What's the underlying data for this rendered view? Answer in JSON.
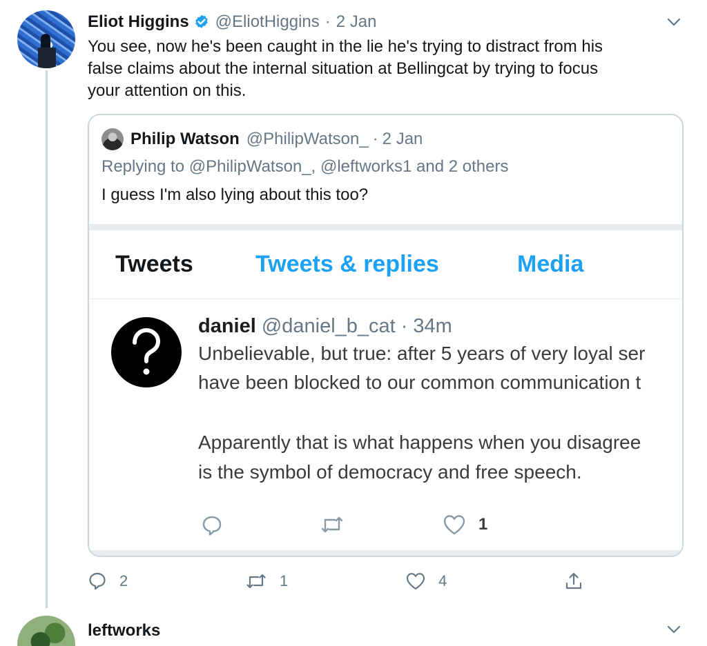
{
  "tweet": {
    "display_name": "Eliot Higgins",
    "handle": "@EliotHiggins",
    "date": "2 Jan",
    "dot": "·",
    "lines": [
      "You see, now he's been caught in the lie he's trying to distract from his",
      "false claims about the internal situation at Bellingcat by trying to focus",
      "your attention on this."
    ],
    "actions": {
      "replies": "2",
      "retweets": "1",
      "likes": "4"
    }
  },
  "quote": {
    "display_name": "Philip Watson",
    "handle": "@PhilipWatson_",
    "dot": "·",
    "date": "2 Jan",
    "replying_prefix": "Replying to ",
    "replying_targets": "@PhilipWatson_, @leftworks1 and 2 others",
    "text": "I guess I'm also lying about this too?",
    "screenshot": {
      "tabs": [
        "Tweets",
        "Tweets & replies",
        "Media"
      ],
      "display_name": "daniel",
      "handle": "@daniel_b_cat",
      "dot": "·",
      "time": "34m",
      "lines": [
        "Unbelievable, but true: after 5 years of very loyal ser",
        "have been blocked to our common communication t",
        "Apparently that is what happens when you disagree",
        "is the symbol of democracy and free speech."
      ],
      "likes": "1"
    }
  },
  "next_tweet": {
    "display_name": "leftworks"
  },
  "colors": {
    "accent": "#1da1f2",
    "muted": "#657786",
    "border": "#ccd6dd"
  },
  "icons": [
    "verified-badge-icon",
    "chevron-down-icon",
    "reply-icon",
    "retweet-icon",
    "like-icon",
    "share-icon",
    "question-mark-icon"
  ]
}
